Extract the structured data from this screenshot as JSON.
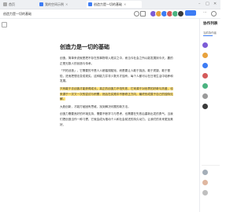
{
  "tabs": [
    {
      "label": "首页"
    },
    {
      "label": "我的空间示例"
    },
    {
      "label": "创造力是一切的基础",
      "active": true
    }
  ],
  "toolbar": {
    "doc_title": "创造力是一切的基础"
  },
  "document": {
    "title": "创造力是一切的基础",
    "paragraphs": [
      "创造，简单来说就是把不存在的事物带入现实之中，而当今社会之所以能发展到今天，靠的正是无数人的创造与传承。",
      "「开拓创造」，它需要的不是人人都循规蹈矩，而是要让人敢于挑战、敢于质疑、敢于冒险，进而把想法变成现实。这种能力并非少数天才独有，每个人都可以在日常生活中培养和发展。",
      "只有敢于去创造才能获得成长。真正的创造力不怕失败，它来源于对世界的好奇与热爱，也来源于一次又一次的尝试与积累，然后在实践中不断修正方向，最终形成属于自己的独特见解。",
      "大胆创新，才能打破固有思维，找到解决问题的新方法。",
      "创造力需要良好的环境支持，需要不断学习与思考，也需要在失败后重新出发的勇气。当我们把创造当作一种习惯，它就会成为推动个人和社会前进的持久动力，让我们的未来更加美好。"
    ],
    "highlight": "创造力是一切的基础",
    "link_text": "创造力"
  },
  "panel": {
    "title": "协作列表",
    "subtitle": "当前协作者",
    "people": [
      {
        "name": "",
        "color": "#7c5cd6"
      },
      {
        "name": "",
        "color": "#e8a23d"
      },
      {
        "name": "",
        "color": "#3d7cf4"
      },
      {
        "name": "",
        "color": "#d45a5a"
      },
      {
        "name": "",
        "color": "#4bb380"
      },
      {
        "name": "",
        "color": "#9a9a9a"
      },
      {
        "name": "",
        "color": "#3a3a3a"
      }
    ],
    "offline": [
      {
        "name": "",
        "color": "#5a6c7d"
      },
      {
        "name": "",
        "color": "#c47b52"
      },
      {
        "name": "",
        "color": "#8a8a8a"
      }
    ]
  },
  "colors": {
    "accent": "#3d7cf4",
    "highlight": "#ffe27a"
  }
}
